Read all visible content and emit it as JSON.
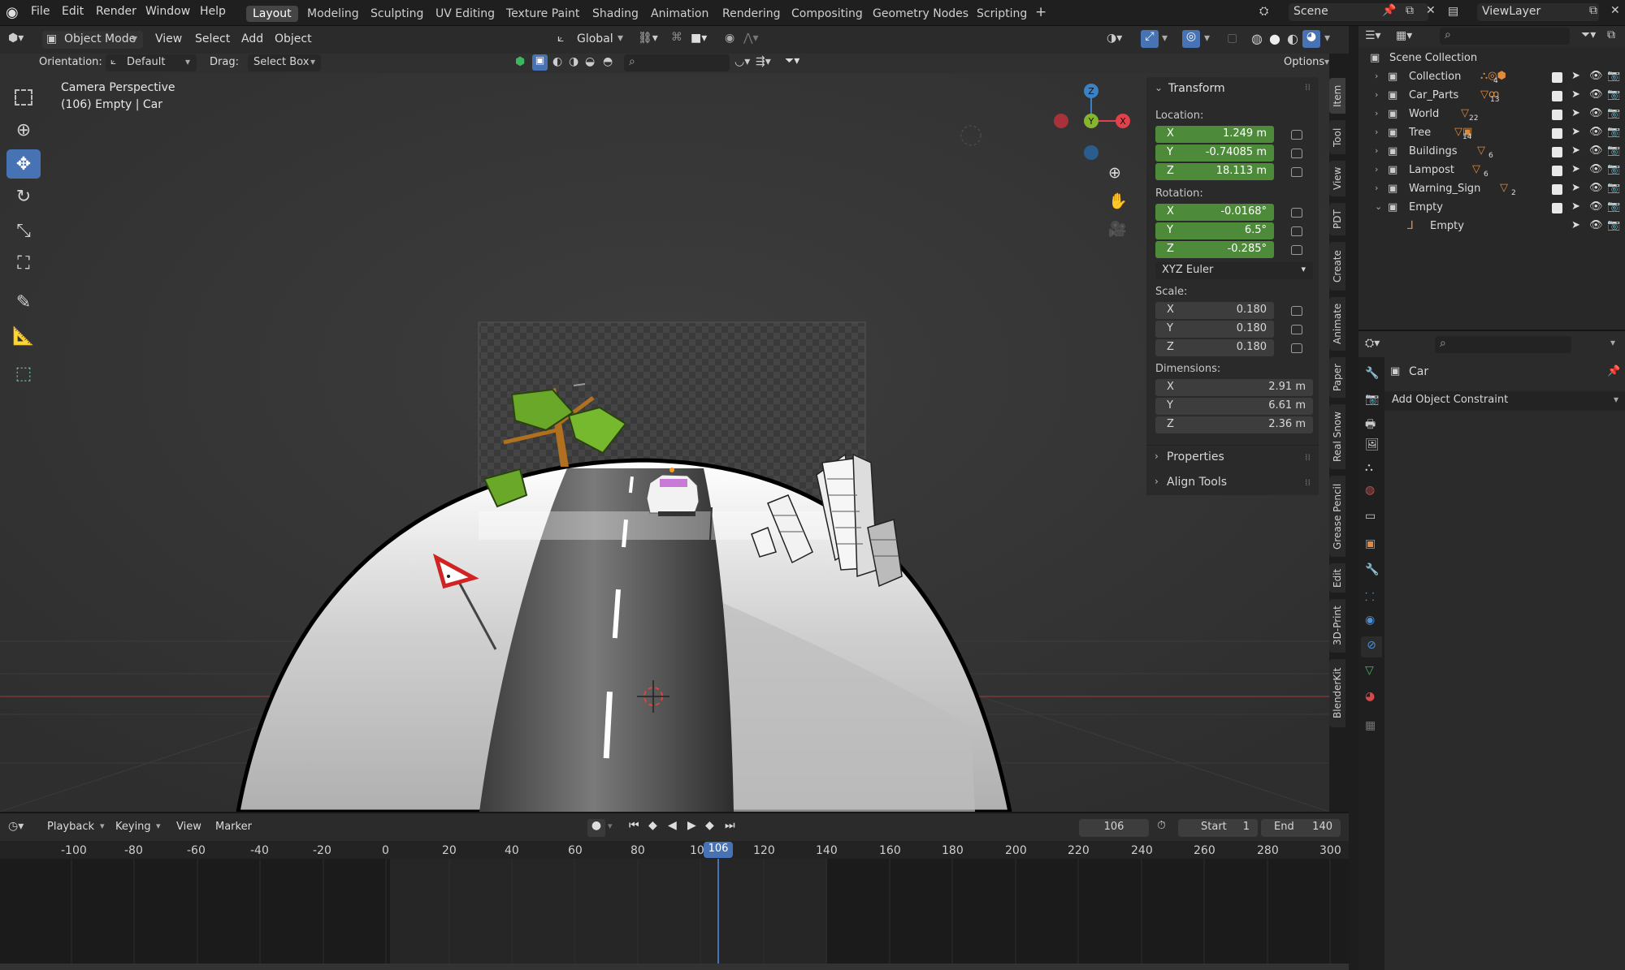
{
  "menus": [
    "File",
    "Edit",
    "Render",
    "Window",
    "Help"
  ],
  "workspaces": [
    "Layout",
    "Modeling",
    "Sculpting",
    "UV Editing",
    "Texture Paint",
    "Shading",
    "Animation",
    "Rendering",
    "Compositing",
    "Geometry Nodes",
    "Scripting"
  ],
  "active_workspace": "Layout",
  "scene_name": "Scene",
  "view_layer": "ViewLayer",
  "header": {
    "mode": "Object Mode",
    "menu": [
      "View",
      "Select",
      "Add",
      "Object"
    ],
    "orientation_transform": "Global",
    "orientation_label": "Orientation:",
    "orientation_value": "Default",
    "drag_label": "Drag:",
    "drag_value": "Select Box",
    "options": "Options"
  },
  "viewport": {
    "camera_text": "Camera Perspective",
    "object_text": "(106) Empty | Car",
    "gizmo": {
      "z": "Z",
      "y": "Y",
      "x": "X"
    }
  },
  "npanel": {
    "title": "Transform",
    "location_label": "Location:",
    "location": [
      {
        "axis": "X",
        "value": "1.249 m"
      },
      {
        "axis": "Y",
        "value": "-0.74085 m"
      },
      {
        "axis": "Z",
        "value": "18.113 m"
      }
    ],
    "rotation_label": "Rotation:",
    "rotation": [
      {
        "axis": "X",
        "value": "-0.0168°"
      },
      {
        "axis": "Y",
        "value": "6.5°"
      },
      {
        "axis": "Z",
        "value": "-0.285°"
      }
    ],
    "rotation_mode": "XYZ Euler",
    "scale_label": "Scale:",
    "scale": [
      {
        "axis": "X",
        "value": "0.180"
      },
      {
        "axis": "Y",
        "value": "0.180"
      },
      {
        "axis": "Z",
        "value": "0.180"
      }
    ],
    "dimensions_label": "Dimensions:",
    "dimensions": [
      {
        "axis": "X",
        "value": "2.91 m"
      },
      {
        "axis": "Y",
        "value": "6.61 m"
      },
      {
        "axis": "Z",
        "value": "2.36 m"
      }
    ],
    "properties": "Properties",
    "align_tools": "Align Tools"
  },
  "side_tabs": [
    "Item",
    "Tool",
    "View",
    "PDT",
    "Create",
    "Animate",
    "Paper",
    "Real Snow",
    "Grease Pencil",
    "Edit",
    "3D-Print",
    "BlenderKit"
  ],
  "outliner": {
    "root": "Scene Collection",
    "items": [
      {
        "name": "Collection",
        "badge": "4"
      },
      {
        "name": "Car_Parts",
        "badge": "13"
      },
      {
        "name": "World",
        "badge": "22"
      },
      {
        "name": "Tree",
        "badge": "14"
      },
      {
        "name": "Buildings",
        "badge": "6"
      },
      {
        "name": "Lampost",
        "badge": "6"
      },
      {
        "name": "Warning_Sign",
        "badge": "2"
      },
      {
        "name": "Empty",
        "badge": ""
      },
      {
        "name": "Empty",
        "badge": ""
      }
    ]
  },
  "properties": {
    "object_name": "Car",
    "constraint_button": "Add Object Constraint"
  },
  "timeline": {
    "menu": [
      "Playback",
      "Keying",
      "View",
      "Marker"
    ],
    "current_frame": "106",
    "start_label": "Start",
    "start": "1",
    "end_label": "End",
    "end": "140",
    "ticks": [
      "-100",
      "-80",
      "-60",
      "-40",
      "-20",
      "0",
      "20",
      "40",
      "60",
      "80",
      "100",
      "120",
      "140",
      "160",
      "180",
      "200",
      "220",
      "240",
      "260",
      "280",
      "300"
    ],
    "playhead": "106"
  }
}
